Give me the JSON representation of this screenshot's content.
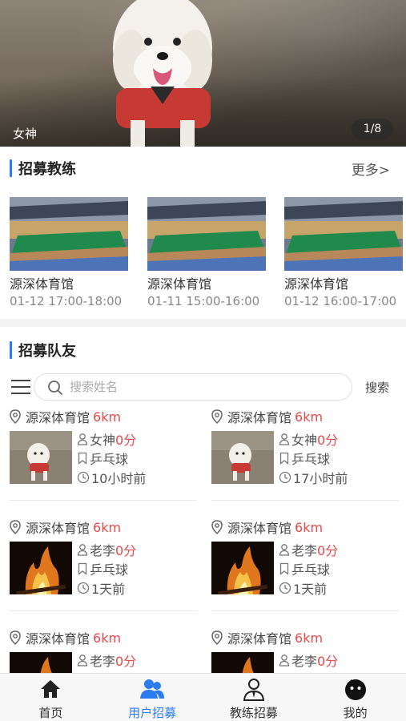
{
  "banner": {
    "caption": "女神",
    "counter": "1/8"
  },
  "coach_section": {
    "title": "招募教练",
    "more": "更多>"
  },
  "coaches": [
    {
      "name": "源深体育馆",
      "time": "01-12 17:00-18:00"
    },
    {
      "name": "源深体育馆",
      "time": "01-11 15:00-16:00"
    },
    {
      "name": "源深体育馆",
      "time": "01-12 16:00-17:00"
    }
  ],
  "team_section": {
    "title": "招募队友"
  },
  "search": {
    "placeholder": "搜索姓名",
    "button": "搜索"
  },
  "teammates": [
    {
      "venue": "源深体育馆",
      "distance": "6km",
      "name": "女神",
      "score": "0分",
      "sport": "乒乓球",
      "time": "10小时前",
      "photo": "dog"
    },
    {
      "venue": "源深体育馆",
      "distance": "6km",
      "name": "女神",
      "score": "0分",
      "sport": "乒乓球",
      "time": "17小时前",
      "photo": "dog"
    },
    {
      "venue": "源深体育馆",
      "distance": "6km",
      "name": "老李",
      "score": "0分",
      "sport": "乒乓球",
      "time": "1天前",
      "photo": "fire"
    },
    {
      "venue": "源深体育馆",
      "distance": "6km",
      "name": "老李",
      "score": "0分",
      "sport": "乒乓球",
      "time": "1天前",
      "photo": "fire"
    },
    {
      "venue": "源深体育馆",
      "distance": "6km",
      "name": "老李",
      "score": "0分",
      "sport": "",
      "time": "",
      "photo": "fire"
    },
    {
      "venue": "源深体育馆",
      "distance": "6km",
      "name": "老李",
      "score": "0分",
      "sport": "",
      "time": "",
      "photo": "fire"
    }
  ],
  "tabbar": [
    {
      "label": "首页",
      "icon": "home-icon",
      "active": false
    },
    {
      "label": "用户招募",
      "icon": "users-icon",
      "active": true
    },
    {
      "label": "教练招募",
      "icon": "coach-icon",
      "active": false
    },
    {
      "label": "我的",
      "icon": "profile-icon",
      "active": false
    }
  ],
  "colors": {
    "accent": "#2b7cf0",
    "highlight": "#e64a4a"
  }
}
